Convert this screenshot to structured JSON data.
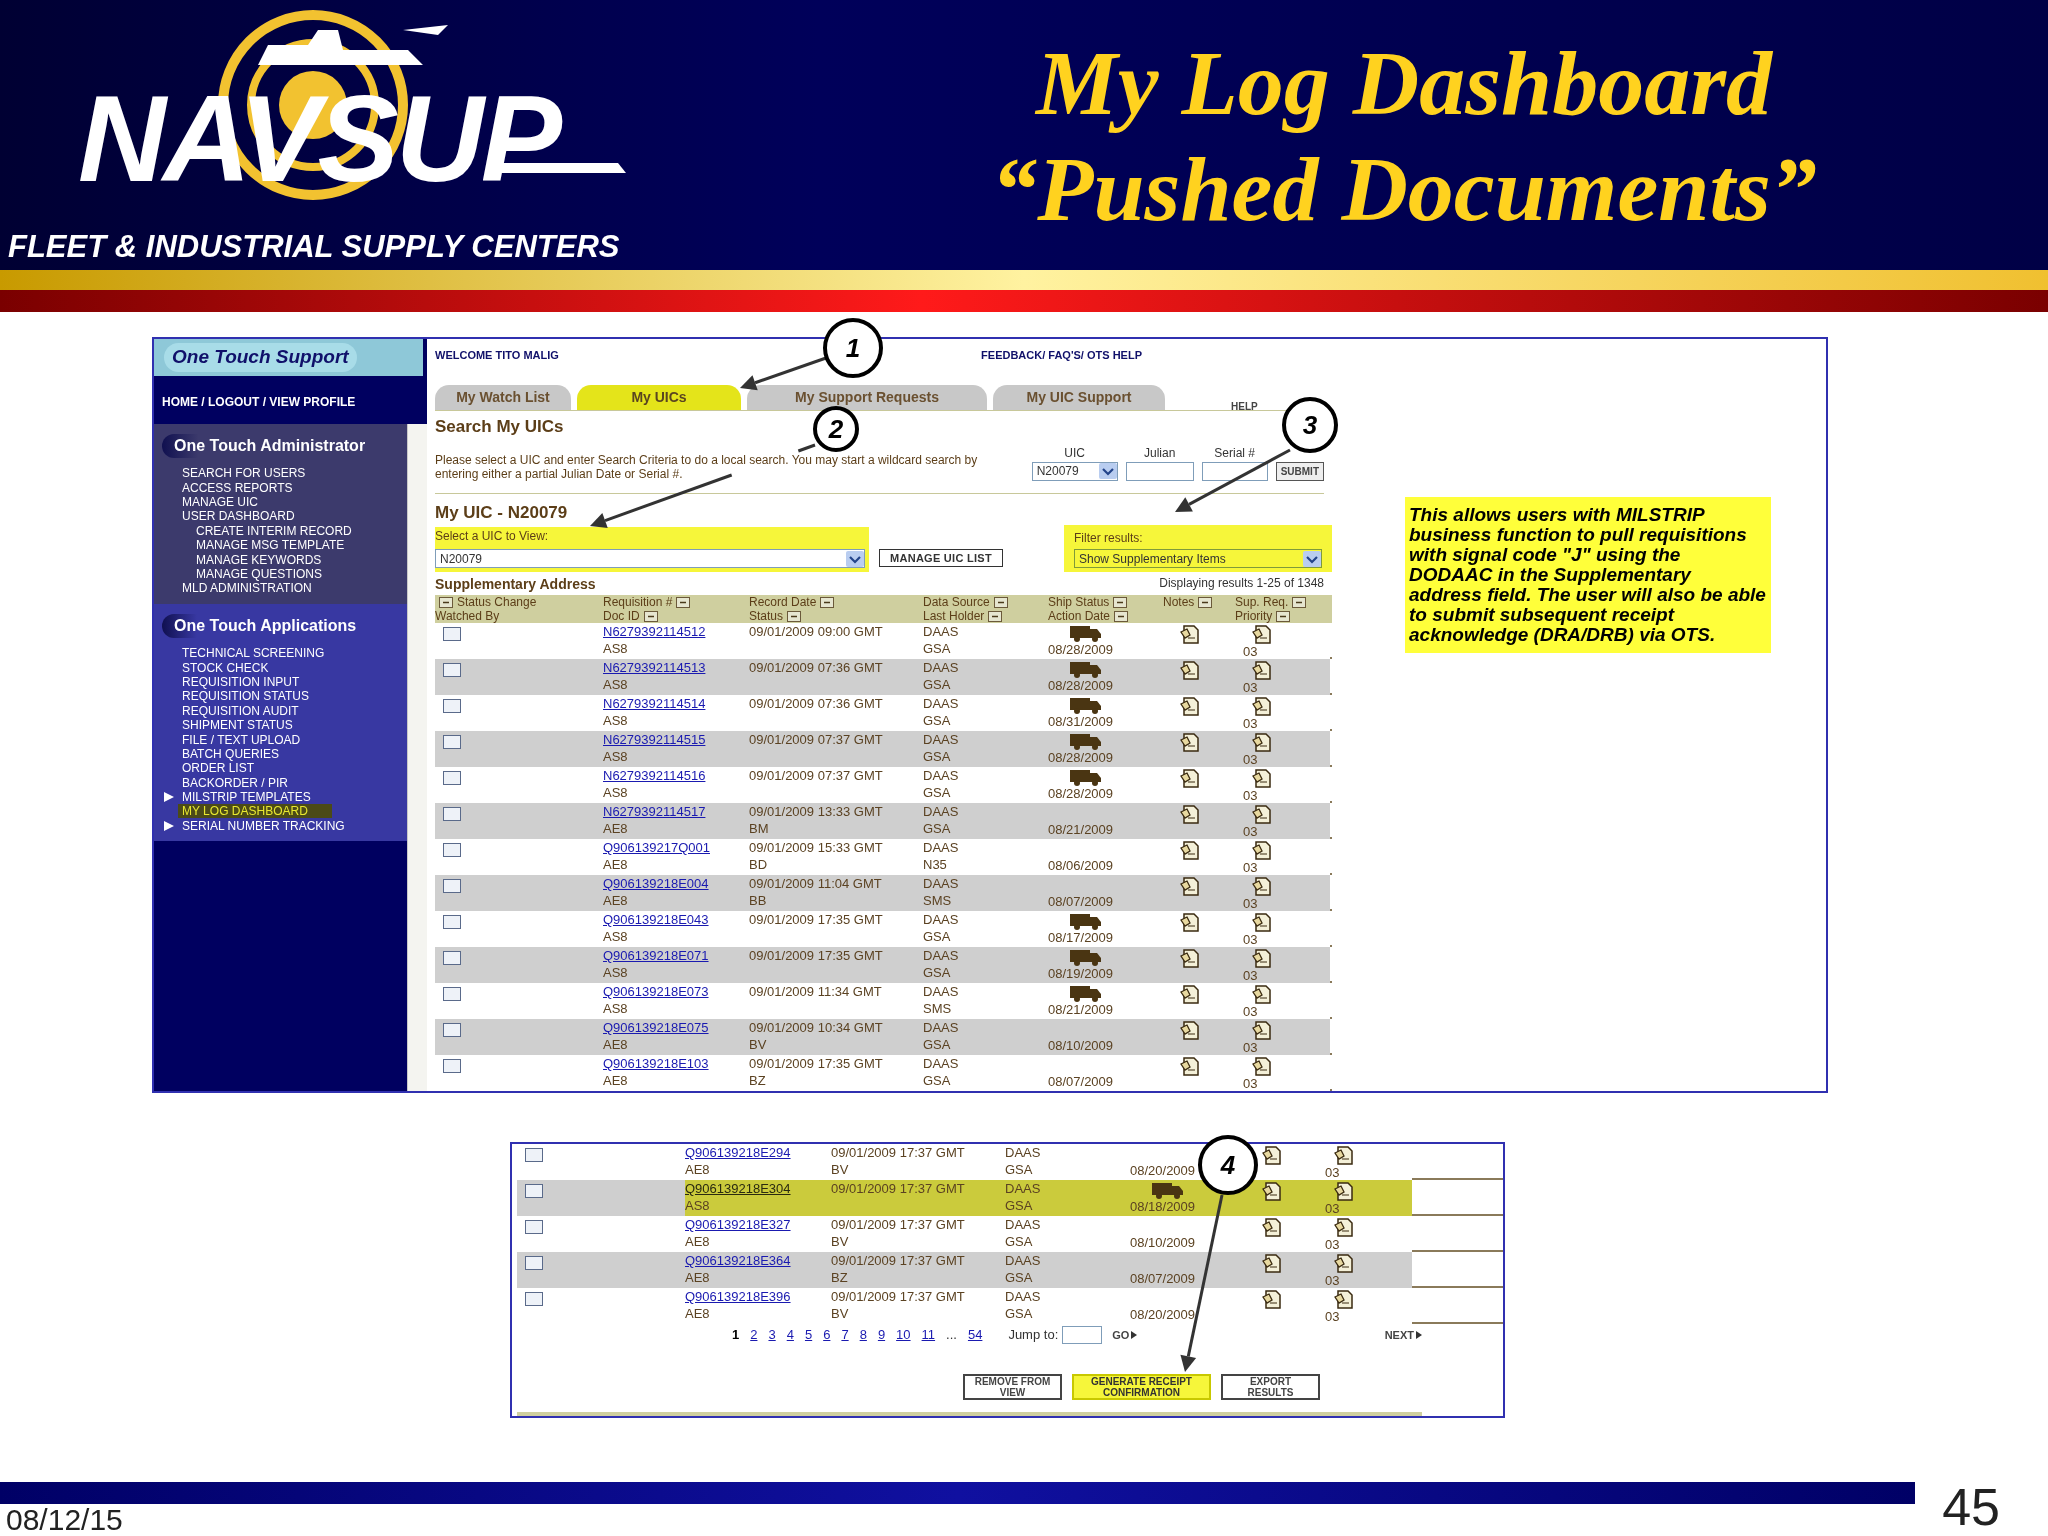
{
  "header": {
    "logo_text": "NAVSUP",
    "subtitle": "FLEET & INDUSTRIAL SUPPLY CENTERS",
    "title_lines": [
      "My Log Dashboard",
      "“Pushed Documents”"
    ]
  },
  "app": {
    "sidebar": {
      "brand": "One Touch Support",
      "top_links": "HOME / LOGOUT / VIEW PROFILE",
      "sections": [
        {
          "title": "One Touch Administrator",
          "items": [
            {
              "label": "SEARCH FOR USERS",
              "kind": "link",
              "selected": false
            },
            {
              "label": "ACCESS REPORTS",
              "kind": "link",
              "selected": false
            },
            {
              "label": "MANAGE UIC",
              "kind": "link",
              "selected": false
            },
            {
              "label": "USER DASHBOARD",
              "kind": "link",
              "selected": false,
              "children": [
                {
                  "label": "CREATE INTERIM RECORD",
                  "selected": false
                },
                {
                  "label": "MANAGE MSG TEMPLATE",
                  "selected": false
                },
                {
                  "label": "MANAGE KEYWORDS",
                  "selected": false
                },
                {
                  "label": "MANAGE QUESTIONS",
                  "selected": false
                }
              ]
            },
            {
              "label": "MLD ADMINISTRATION",
              "kind": "link",
              "selected": false
            }
          ]
        },
        {
          "title": "One Touch Applications",
          "items": [
            {
              "label": "TECHNICAL SCREENING",
              "kind": "link",
              "selected": false
            },
            {
              "label": "STOCK CHECK",
              "kind": "link",
              "selected": false
            },
            {
              "label": "REQUISITION INPUT",
              "kind": "link",
              "selected": false
            },
            {
              "label": "REQUISITION STATUS",
              "kind": "link",
              "selected": false
            },
            {
              "label": "REQUISITION AUDIT",
              "kind": "link",
              "selected": false
            },
            {
              "label": "SHIPMENT STATUS",
              "kind": "link",
              "selected": false
            },
            {
              "label": "FILE / TEXT UPLOAD",
              "kind": "link",
              "selected": false
            },
            {
              "label": "BATCH QUERIES",
              "kind": "link",
              "selected": false
            },
            {
              "label": "ORDER LIST",
              "kind": "link",
              "selected": false
            },
            {
              "label": "BACKORDER / PIR",
              "kind": "link",
              "selected": false
            },
            {
              "label": "MILSTRIP TEMPLATES",
              "kind": "folder",
              "selected": false
            },
            {
              "label": "MY LOG DASHBOARD",
              "kind": "link",
              "selected": true
            },
            {
              "label": "SERIAL NUMBER TRACKING",
              "kind": "folder",
              "selected": false
            }
          ]
        }
      ]
    },
    "main": {
      "welcome": "WELCOME TITO MALIG",
      "top_links": "FEEDBACK/ FAQ'S/ OTS HELP",
      "tabs": [
        {
          "label": "My Watch List",
          "selected": false
        },
        {
          "label": "My UICs",
          "selected": true
        },
        {
          "label": "My Support Requests",
          "selected": false
        },
        {
          "label": "My UIC Support",
          "selected": false
        }
      ],
      "help": "HELP",
      "search": {
        "title": "Search My UICs",
        "instructions": "Please select a UIC and enter Search Criteria to do a local search. You may start a wildcard search by entering either a partial Julian Date or Serial #.",
        "uic_label": "UIC",
        "uic_value": "N20079",
        "julian_label": "Julian",
        "serial_label": "Serial #",
        "submit": "SUBMIT"
      },
      "uic": {
        "title": "My UIC - N20079",
        "select_label": "Select a UIC to View:",
        "select_value": "N20079",
        "highlighted": true,
        "manage_button": "MANAGE UIC LIST"
      },
      "filter": {
        "label": "Filter results:",
        "value": "Show Supplementary Items",
        "highlighted": true
      },
      "table": {
        "title": "Supplementary Address",
        "count": "Displaying results 1-25 of 1348",
        "columns": [
          {
            "lines": [
              {
                "label": "Status Change",
                "sortable": true
              },
              {
                "label": "Watched By",
                "sortable": false
              }
            ]
          },
          {
            "lines": [
              {
                "label": "Requisition #",
                "sortable": true
              },
              {
                "label": "Doc ID",
                "sortable": true
              }
            ]
          },
          {
            "lines": [
              {
                "label": "Record Date",
                "sortable": true
              },
              {
                "label": "Status",
                "sortable": true
              }
            ]
          },
          {
            "lines": [
              {
                "label": "Data Source",
                "sortable": true
              },
              {
                "label": "Last Holder",
                "sortable": true
              }
            ]
          },
          {
            "lines": [
              {
                "label": "Ship Status",
                "sortable": true
              },
              {
                "label": "Action Date",
                "sortable": true
              }
            ]
          },
          {
            "lines": [
              {
                "label": "Notes",
                "sortable": true
              }
            ]
          },
          {
            "lines": [
              {
                "label": "Sup. Req.",
                "sortable": true
              },
              {
                "label": "Priority",
                "sortable": true
              }
            ]
          }
        ],
        "rows": [
          {
            "checked": false,
            "req": "N6279392114512",
            "doc_id": "AS8",
            "date": "09/01/2009 09:00 GMT",
            "source": "DAAS",
            "holder": "GSA",
            "shipped": true,
            "action_date": "08/28/2009",
            "priority": "03"
          },
          {
            "checked": false,
            "req": "N6279392114513",
            "doc_id": "AS8",
            "date": "09/01/2009 07:36 GMT",
            "source": "DAAS",
            "holder": "GSA",
            "shipped": true,
            "action_date": "08/28/2009",
            "priority": "03"
          },
          {
            "checked": false,
            "req": "N6279392114514",
            "doc_id": "AS8",
            "date": "09/01/2009 07:36 GMT",
            "source": "DAAS",
            "holder": "GSA",
            "shipped": true,
            "action_date": "08/31/2009",
            "priority": "03"
          },
          {
            "checked": false,
            "req": "N6279392114515",
            "doc_id": "AS8",
            "date": "09/01/2009 07:37 GMT",
            "source": "DAAS",
            "holder": "GSA",
            "shipped": true,
            "action_date": "08/28/2009",
            "priority": "03"
          },
          {
            "checked": false,
            "req": "N6279392114516",
            "doc_id": "AS8",
            "date": "09/01/2009 07:37 GMT",
            "source": "DAAS",
            "holder": "GSA",
            "shipped": true,
            "action_date": "08/28/2009",
            "priority": "03"
          },
          {
            "checked": false,
            "req": "N6279392114517",
            "doc_id": "AE8",
            "date": "09/01/2009 13:33 GMT",
            "status": "BM",
            "source": "DAAS",
            "holder": "GSA",
            "shipped": false,
            "action_date": "08/21/2009",
            "priority": "03"
          },
          {
            "checked": false,
            "req": "Q906139217Q001",
            "doc_id": "AE8",
            "date": "09/01/2009 15:33 GMT",
            "status": "BD",
            "source": "DAAS",
            "holder": "N35",
            "shipped": false,
            "action_date": "08/06/2009",
            "priority": "03"
          },
          {
            "checked": false,
            "req": "Q906139218E004",
            "doc_id": "AE8",
            "date": "09/01/2009 11:04 GMT",
            "status": "BB",
            "source": "DAAS",
            "holder": "SMS",
            "shipped": false,
            "action_date": "08/07/2009",
            "priority": "03"
          },
          {
            "checked": false,
            "req": "Q906139218E043",
            "doc_id": "AS8",
            "date": "09/01/2009 17:35 GMT",
            "source": "DAAS",
            "holder": "GSA",
            "shipped": true,
            "action_date": "08/17/2009",
            "priority": "03"
          },
          {
            "checked": false,
            "req": "Q906139218E071",
            "doc_id": "AS8",
            "date": "09/01/2009 17:35 GMT",
            "source": "DAAS",
            "holder": "GSA",
            "shipped": true,
            "action_date": "08/19/2009",
            "priority": "03"
          },
          {
            "checked": false,
            "req": "Q906139218E073",
            "doc_id": "AS8",
            "date": "09/01/2009 11:34 GMT",
            "source": "DAAS",
            "holder": "SMS",
            "shipped": true,
            "action_date": "08/21/2009",
            "priority": "03"
          },
          {
            "checked": false,
            "req": "Q906139218E075",
            "doc_id": "AE8",
            "date": "09/01/2009 10:34 GMT",
            "status": "BV",
            "source": "DAAS",
            "holder": "GSA",
            "shipped": false,
            "action_date": "08/10/2009",
            "priority": "03"
          },
          {
            "checked": false,
            "req": "Q906139218E103",
            "doc_id": "AE8",
            "date": "09/01/2009 17:35 GMT",
            "status": "BZ",
            "source": "DAAS",
            "holder": "GSA",
            "shipped": false,
            "action_date": "08/07/2009",
            "priority": "03"
          }
        ]
      }
    }
  },
  "note": "This allows users with MILSTRIP business function to pull requisitions with signal code \"J\" using the DODAAC in the Supplementary address field. The user will also be able to submit subsequent receipt acknowledge (DRA/DRB) via OTS.",
  "bottom_panel": {
    "rows": [
      {
        "checked": false,
        "highlighted": false,
        "req": "Q906139218E294",
        "doc_id": "AE8",
        "date": "09/01/2009 17:37 GMT",
        "status": "BV",
        "source": "DAAS",
        "holder": "GSA",
        "shipped": false,
        "action_date": "08/20/2009",
        "priority": "03"
      },
      {
        "checked": false,
        "highlighted": true,
        "req": "Q906139218E304",
        "doc_id": "AS8",
        "date": "09/01/2009 17:37 GMT",
        "source": "DAAS",
        "holder": "GSA",
        "shipped": true,
        "action_date": "08/18/2009",
        "priority": "03"
      },
      {
        "checked": false,
        "highlighted": false,
        "req": "Q906139218E327",
        "doc_id": "AE8",
        "date": "09/01/2009 17:37 GMT",
        "status": "BV",
        "source": "DAAS",
        "holder": "GSA",
        "shipped": false,
        "action_date": "08/10/2009",
        "priority": "03"
      },
      {
        "checked": false,
        "highlighted": false,
        "req": "Q906139218E364",
        "doc_id": "AE8",
        "date": "09/01/2009 17:37 GMT",
        "status": "BZ",
        "source": "DAAS",
        "holder": "GSA",
        "shipped": false,
        "action_date": "08/07/2009",
        "priority": "03"
      },
      {
        "checked": false,
        "highlighted": false,
        "req": "Q906139218E396",
        "doc_id": "AE8",
        "date": "09/01/2009 17:37 GMT",
        "status": "BV",
        "source": "DAAS",
        "holder": "GSA",
        "shipped": false,
        "action_date": "08/20/2009",
        "priority": "03"
      }
    ],
    "pages": [
      {
        "label": "1",
        "kind": "page",
        "selected": true
      },
      {
        "label": "2",
        "kind": "page",
        "selected": false
      },
      {
        "label": "3",
        "kind": "page",
        "selected": false
      },
      {
        "label": "4",
        "kind": "page",
        "selected": false
      },
      {
        "label": "5",
        "kind": "page",
        "selected": false
      },
      {
        "label": "6",
        "kind": "page",
        "selected": false
      },
      {
        "label": "7",
        "kind": "page",
        "selected": false
      },
      {
        "label": "8",
        "kind": "page",
        "selected": false
      },
      {
        "label": "9",
        "kind": "page",
        "selected": false
      },
      {
        "label": "10",
        "kind": "page",
        "selected": false
      },
      {
        "label": "11",
        "kind": "page",
        "selected": false
      },
      {
        "label": "...",
        "kind": "gap"
      },
      {
        "label": "54",
        "kind": "page",
        "selected": false
      }
    ],
    "jump_label": "Jump to:",
    "go": "GO",
    "next": "NEXT",
    "buttons": [
      {
        "label": "REMOVE FROM VIEW",
        "highlighted": false
      },
      {
        "label": "GENERATE RECEIPT CONFIRMATION",
        "highlighted": true
      },
      {
        "label": "EXPORT RESULTS",
        "highlighted": false
      }
    ]
  },
  "callouts": [
    {
      "number": "1"
    },
    {
      "number": "2"
    },
    {
      "number": "3"
    },
    {
      "number": "4"
    }
  ],
  "footer": {
    "date": "08/12/15",
    "page": "45"
  }
}
